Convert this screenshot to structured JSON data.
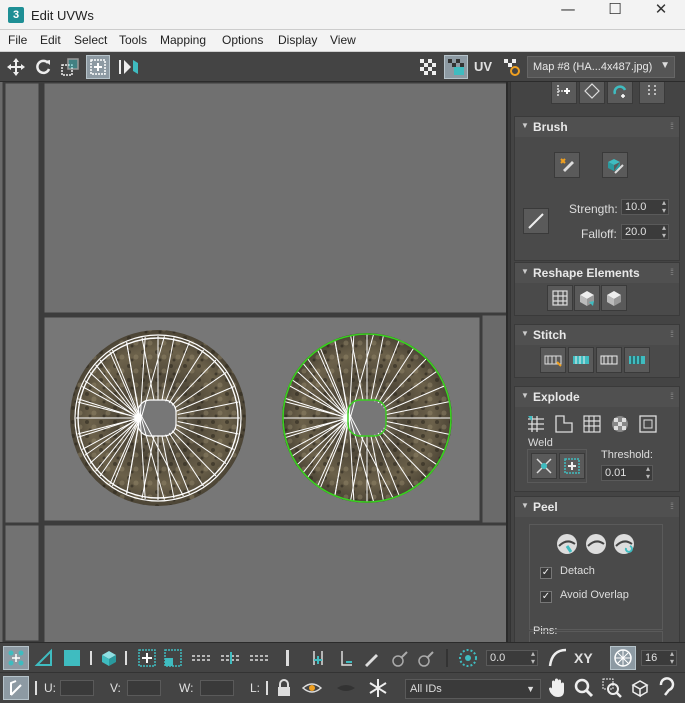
{
  "window": {
    "app_icon": "3",
    "title": "Edit UVWs",
    "minimize_icon": "—",
    "maximize_icon": "☐",
    "close_icon": "✕"
  },
  "menu": [
    "File",
    "Edit",
    "Select",
    "Tools",
    "Mapping",
    "Options",
    "Display",
    "View"
  ],
  "toolbar": {
    "uv_label": "UV",
    "map_selector": "Map #8 (HA...4x487.jpg)",
    "accent": "#3fbcc0"
  },
  "brush": {
    "title": "Brush",
    "strength_label": "Strength:",
    "strength_value": "10.0",
    "falloff_label": "Falloff:",
    "falloff_value": "20.0"
  },
  "reshape": {
    "title": "Reshape Elements"
  },
  "stitch": {
    "title": "Stitch"
  },
  "explode": {
    "title": "Explode",
    "weld_label": "Weld",
    "threshold_label": "Threshold:",
    "threshold_value": "0.01"
  },
  "peel": {
    "title": "Peel",
    "detach_label": "Detach",
    "detach_checked": true,
    "avoid_overlap_label": "Avoid Overlap",
    "avoid_overlap_checked": true,
    "pins_label": "Pins:"
  },
  "bottom": {
    "angle_value": "0.0",
    "xy_label": "XY",
    "grid_value": "16",
    "u_label": "U:",
    "u_value": "",
    "v_label": "V:",
    "v_value": "",
    "w_label": "W:",
    "w_value": "",
    "l_label": "L:",
    "ids_dropdown": "All IDs"
  },
  "colors": {
    "selection_green": "#39d020",
    "viewport_bg": "#6f6f6f"
  }
}
